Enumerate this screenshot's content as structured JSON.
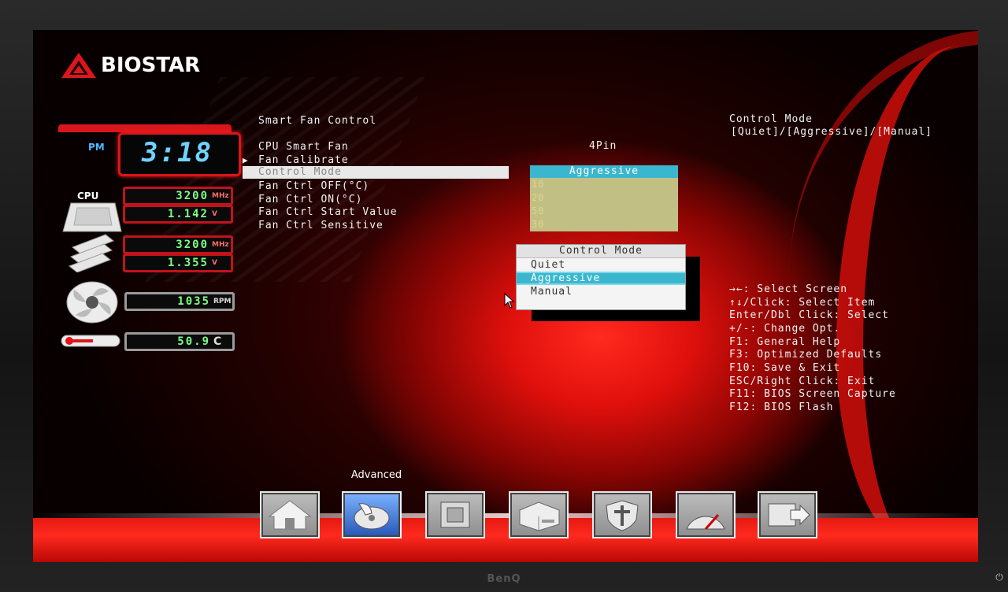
{
  "brand": {
    "logo_text": "BIOSTAR",
    "monitor_brand": "BenQ",
    "power_icon": "power-icon"
  },
  "hw_monitor": {
    "ampm": "PM",
    "time": "3:18",
    "cpu_label": "CPU",
    "cpu_freq": "3200",
    "cpu_freq_unit": "MHz",
    "cpu_volt": "1.142",
    "cpu_volt_unit": "V",
    "mem_freq": "3200",
    "mem_freq_unit": "MHz",
    "mem_volt": "1.355",
    "mem_volt_unit": "V",
    "fan_rpm": "1035",
    "fan_unit": "RPM",
    "temp": "50.9",
    "temp_unit": "C"
  },
  "menu": {
    "section_title": "Smart Fan Control",
    "fan_header_label": "CPU Smart Fan",
    "fan_header_value": "4Pin",
    "items": [
      {
        "label": "Fan Calibrate",
        "has_arrow": true
      },
      {
        "label": "Control Mode",
        "highlighted": true
      },
      {
        "label": "Fan Ctrl OFF(°C)"
      },
      {
        "label": "Fan Ctrl ON(°C)"
      },
      {
        "label": "Fan Ctrl Start Value"
      },
      {
        "label": "Fan Ctrl Sensitive"
      }
    ],
    "values": {
      "current": "Aggressive",
      "lines": [
        "10",
        "20",
        "50",
        "30"
      ]
    }
  },
  "popup": {
    "title": "Control Mode",
    "options": [
      {
        "label": "Quiet",
        "selected": false
      },
      {
        "label": "Aggressive",
        "selected": true
      },
      {
        "label": "Manual",
        "selected": false
      }
    ]
  },
  "help": {
    "item_title": "Control Mode",
    "item_options": "[Quiet]/[Aggressive]/[Manual]",
    "keys": [
      "→←: Select Screen",
      "↑↓/Click: Select Item",
      "Enter/Dbl Click: Select",
      "+/-: Change Opt.",
      "F1: General Help",
      "F3: Optimized Defaults",
      "F10: Save & Exit",
      "ESC/Right Click: Exit",
      "F11: BIOS Screen Capture",
      "F12: BIOS Flash"
    ]
  },
  "nav": {
    "active_label": "Advanced",
    "buttons": [
      "home-icon",
      "advanced-icon",
      "chipset-icon",
      "boot-icon",
      "security-icon",
      "o-n-e-icon",
      "save-exit-icon"
    ]
  },
  "colors": {
    "accent_red": "#e51912",
    "selection_cyan": "#3ab7cf",
    "value_box": "#c2bf84"
  }
}
